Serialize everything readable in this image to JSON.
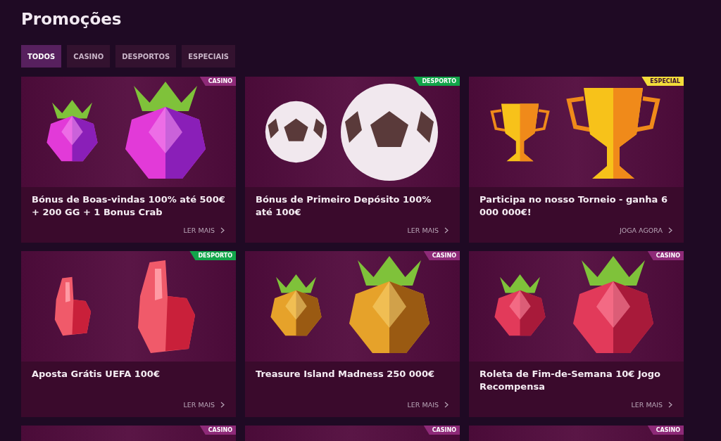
{
  "title": "Promoções",
  "tabs": [
    {
      "label": "TODOS",
      "selected": true
    },
    {
      "label": "CASINO",
      "selected": false
    },
    {
      "label": "DESPORTOS",
      "selected": false
    },
    {
      "label": "ESPECIAIS",
      "selected": false
    }
  ],
  "cards": [
    {
      "tag": "CASINO",
      "color": "#8e2a78",
      "kind": "raspberry",
      "title": "Bónus de Boas-vindas 100% até 500€ + 200 GG + 1 Bonus Crab",
      "link": "LER MAIS"
    },
    {
      "tag": "DESPORTO",
      "color": "#12a54a",
      "kind": "ball",
      "title": "Bónus de Primeiro Depósito 100% até 100€",
      "link": "LER MAIS"
    },
    {
      "tag": "ESPECIAL",
      "color": "#f2dc3a",
      "kind": "trophy",
      "title": "Participa no nosso Torneio - ganha 6 000 000€!",
      "link": "JOGA AGORA"
    },
    {
      "tag": "DESPORTO",
      "color": "#12a54a",
      "kind": "hand",
      "title": "Aposta Grátis UEFA 100€",
      "link": "LER MAIS"
    },
    {
      "tag": "CASINO",
      "color": "#8e2a78",
      "kind": "pineapple",
      "title": "Treasure Island Madness 250 000€",
      "link": "LER MAIS"
    },
    {
      "tag": "CASINO",
      "color": "#8e2a78",
      "kind": "dragonfruit",
      "title": "Roleta de Fim-de-Semana 10€ Jogo Recompensa",
      "link": "LER MAIS"
    },
    {
      "tag": "CASINO",
      "color": "#8e2a78"
    },
    {
      "tag": "CASINO",
      "color": "#8e2a78"
    },
    {
      "tag": "CASINO",
      "color": "#8e2a78"
    }
  ]
}
